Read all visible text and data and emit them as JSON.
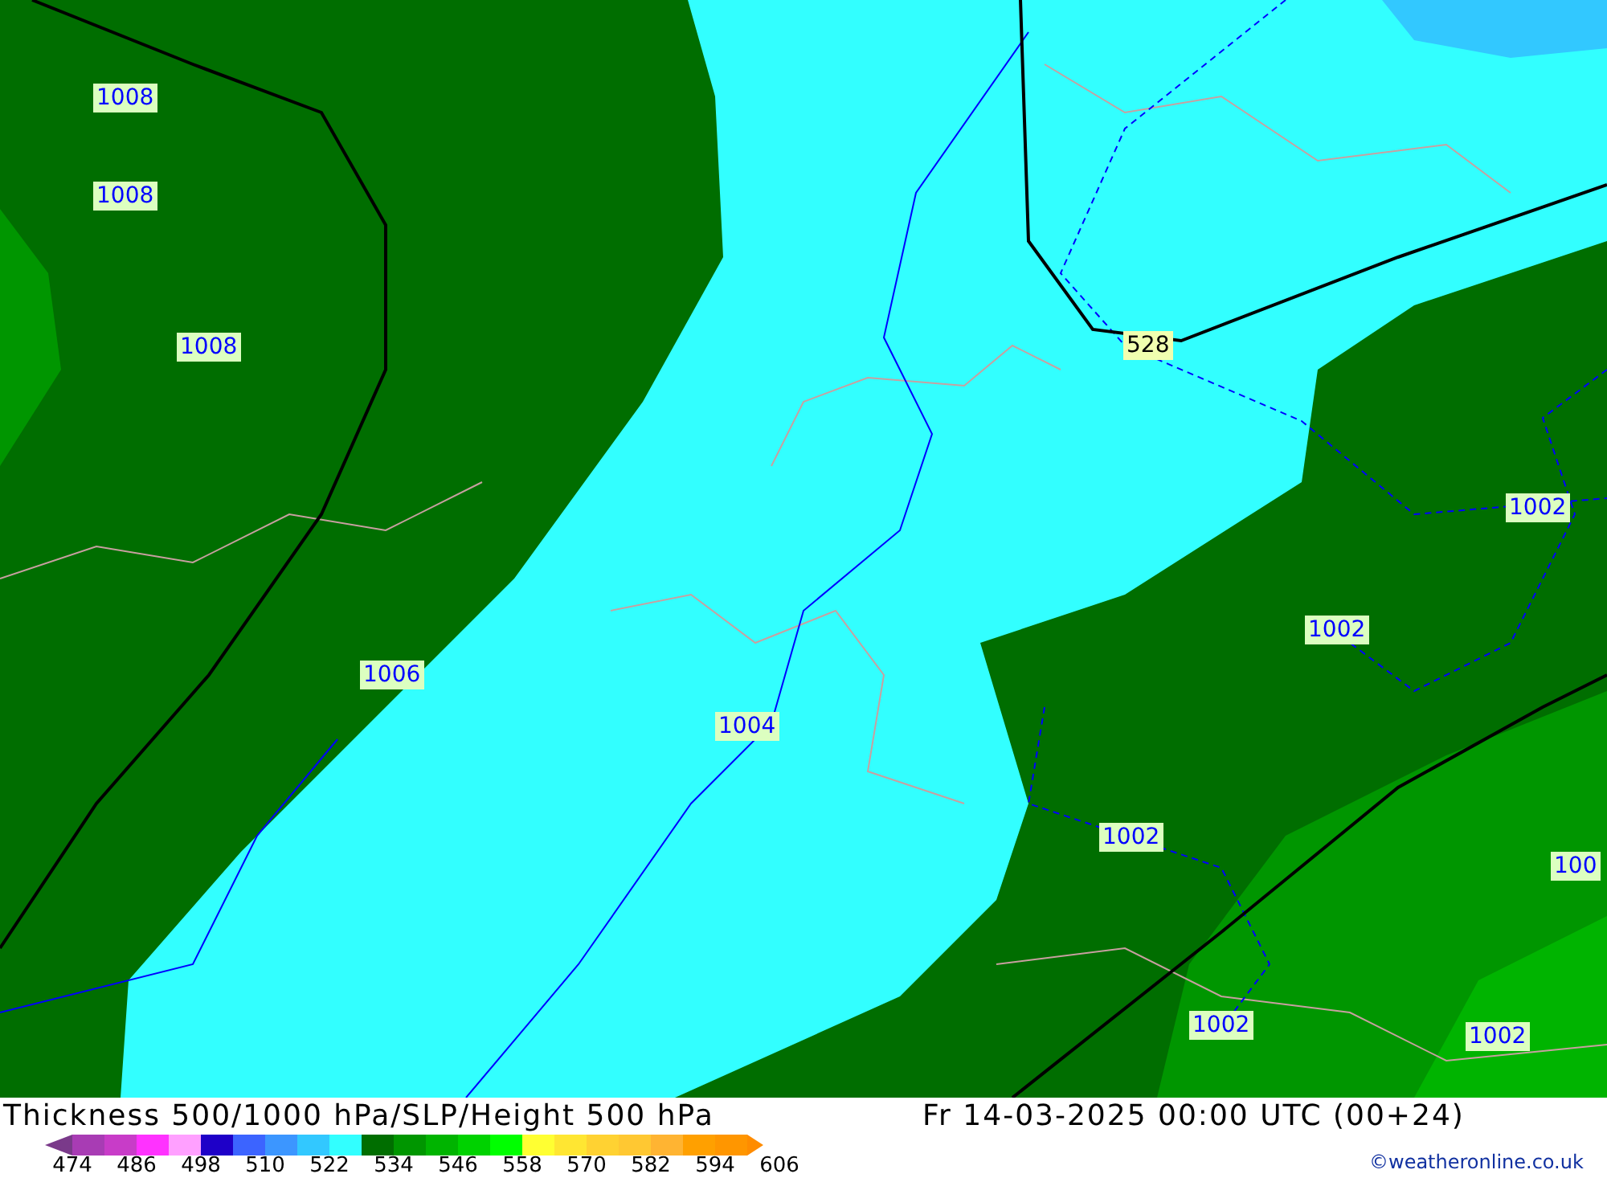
{
  "map": {
    "labels": [
      {
        "kind": "pressure",
        "text": "1008"
      },
      {
        "kind": "pressure",
        "text": "1008"
      },
      {
        "kind": "pressure",
        "text": "1008"
      },
      {
        "kind": "thickness",
        "text": "528"
      },
      {
        "kind": "pressure",
        "text": "1002"
      },
      {
        "kind": "pressure",
        "text": "1002"
      },
      {
        "kind": "pressure",
        "text": "1006"
      },
      {
        "kind": "pressure",
        "text": "1004"
      },
      {
        "kind": "pressure",
        "text": "1002"
      },
      {
        "kind": "pressure",
        "text": "100"
      },
      {
        "kind": "pressure",
        "text": "1002"
      },
      {
        "kind": "pressure",
        "text": "1002"
      }
    ]
  },
  "legend": {
    "title": "Thickness 500/1000 hPa/SLP/Height 500 hPa",
    "valid_time": "Fr 14-03-2025 00:00 UTC (00+24)",
    "credit": "©weatheronline.co.uk",
    "swatches": [
      {
        "color": "#a83cb4"
      },
      {
        "color": "#c83cc8"
      },
      {
        "color": "#ff32ff"
      },
      {
        "color": "#ffa0ff"
      },
      {
        "color": "#1e00c8"
      },
      {
        "color": "#3c64ff"
      },
      {
        "color": "#3c96ff"
      },
      {
        "color": "#32c8ff"
      },
      {
        "color": "#32ffff"
      },
      {
        "color": "#006e00"
      },
      {
        "color": "#009600"
      },
      {
        "color": "#00b400"
      },
      {
        "color": "#00d200"
      },
      {
        "color": "#00ff00"
      },
      {
        "color": "#ffff32"
      },
      {
        "color": "#ffe632"
      },
      {
        "color": "#ffd232"
      },
      {
        "color": "#ffc832"
      },
      {
        "color": "#ffb432"
      },
      {
        "color": "#ffa000"
      },
      {
        "color": "#ff9600"
      }
    ],
    "ticks": [
      "474",
      "486",
      "498",
      "510",
      "522",
      "534",
      "546",
      "558",
      "570",
      "582",
      "594",
      "606"
    ]
  }
}
